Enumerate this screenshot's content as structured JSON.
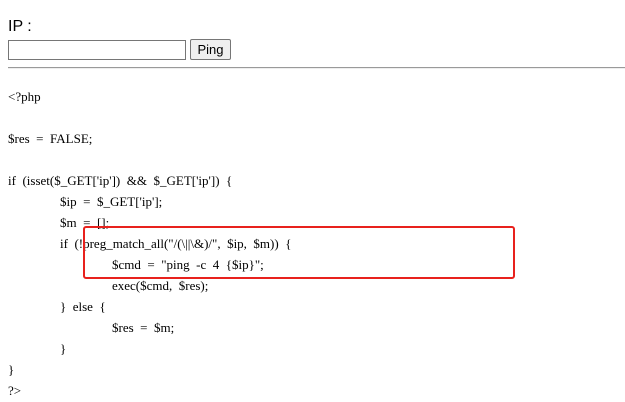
{
  "form": {
    "label": "IP :",
    "input_value": "",
    "button_label": "Ping"
  },
  "code": {
    "open_tag": "<?php",
    "res_assign": "$res  =  FALSE;",
    "if_isset": "if  (isset($_GET['ip'])  &&  $_GET['ip'])  {",
    "ip_assign": "$ip  =  $_GET['ip'];",
    "m_assign": "$m  =  [];",
    "if_preg": "if  (!preg_match_all(\"/(\\||\\&)/\",  $ip,  $m))  {",
    "cmd_assign": "$cmd  =  \"ping  -c  4  {$ip}\";",
    "exec_call": "exec($cmd,  $res);",
    "else_line": "}  else  {",
    "res_m_assign": "$res  =  $m;",
    "inner_close": "}",
    "outer_close": "}",
    "close_tag": "?>"
  },
  "annotation": {
    "box_color": "#e8211d"
  }
}
